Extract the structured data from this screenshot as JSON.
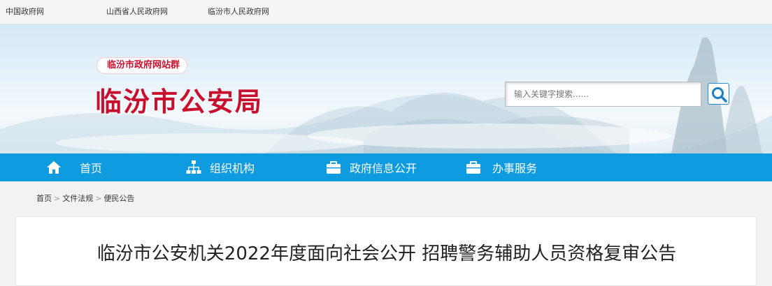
{
  "topbar": {
    "links": [
      "中国政府网",
      "山西省人民政府网",
      "临汾市人民政府网"
    ]
  },
  "header": {
    "site_group": "临汾市政府网站群",
    "site_title": "临汾市公安局",
    "search_placeholder": "输入关键字搜索......"
  },
  "nav": {
    "items": [
      {
        "label": "首页",
        "icon": "home-icon"
      },
      {
        "label": "组织机构",
        "icon": "org-chart-icon"
      },
      {
        "label": "政府信息公开",
        "icon": "briefcase-icon"
      },
      {
        "label": "办事服务",
        "icon": "briefcase-icon"
      }
    ]
  },
  "breadcrumb": {
    "items": [
      "首页",
      "文件法规",
      "便民公告"
    ],
    "separator": ">"
  },
  "article": {
    "title": "临汾市公安机关2022年度面向社会公开 招聘警务辅助人员资格复审公告"
  },
  "colors": {
    "nav_bg": "#0e9be0",
    "title_red": "#c8102e"
  }
}
